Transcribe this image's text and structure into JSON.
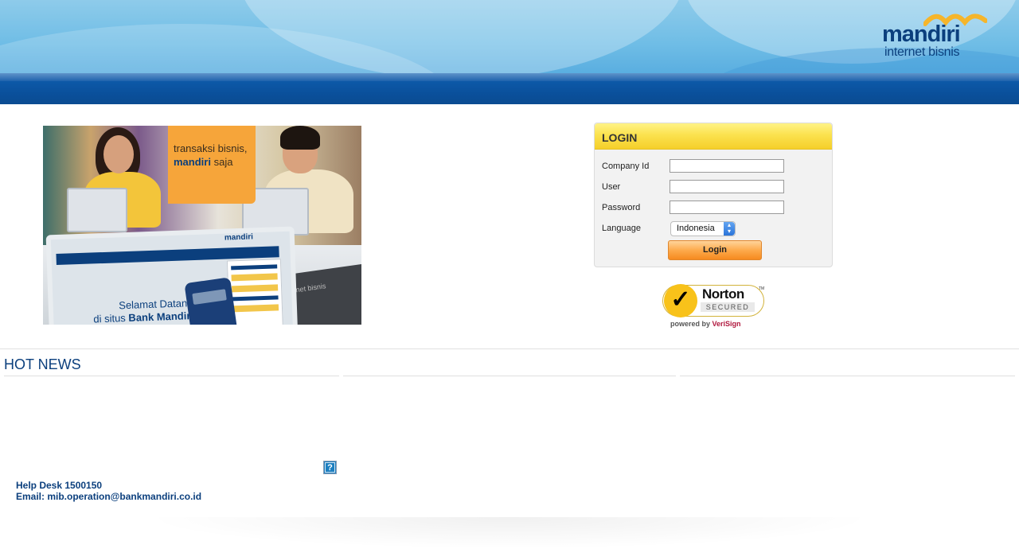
{
  "header": {
    "brand": "mandiri",
    "subbrand": "internet bisnis"
  },
  "banner": {
    "caption_line1": "transaksi bisnis,",
    "caption_brand": "mandiri",
    "caption_tail": "saja",
    "screen_logo": "mandiri",
    "welcome_line1": "Selamat Datang",
    "welcome_line2_prefix": "di situs",
    "welcome_line2_bold": "Bank Mandiri",
    "box_text": "internet bisnis"
  },
  "login": {
    "title": "LOGIN",
    "company_label": "Company Id",
    "company_value": "",
    "user_label": "User",
    "user_value": "",
    "password_label": "Password",
    "password_value": "",
    "language_label": "Language",
    "language_value": "Indonesia",
    "button_label": "Login"
  },
  "norton": {
    "name": "Norton",
    "secured": "SECURED",
    "tm": "TM",
    "powered_prefix": "powered by",
    "powered_brand": "VeriSign",
    "colors": {
      "gold": "#f8c21a",
      "verisign": "#b0173d"
    }
  },
  "news": {
    "title": "HOT NEWS"
  },
  "help": {
    "icon": "help-icon",
    "icon_glyph": "?",
    "helpdesk": "Help Desk 1500150",
    "email": "Email: mib.operation@bankmandiri.co.id"
  },
  "colors": {
    "brand_blue": "#0b3f7d",
    "header_band": "#0a4f9a",
    "login_header": "#fbe24f",
    "login_button": "#fdaa4c"
  }
}
